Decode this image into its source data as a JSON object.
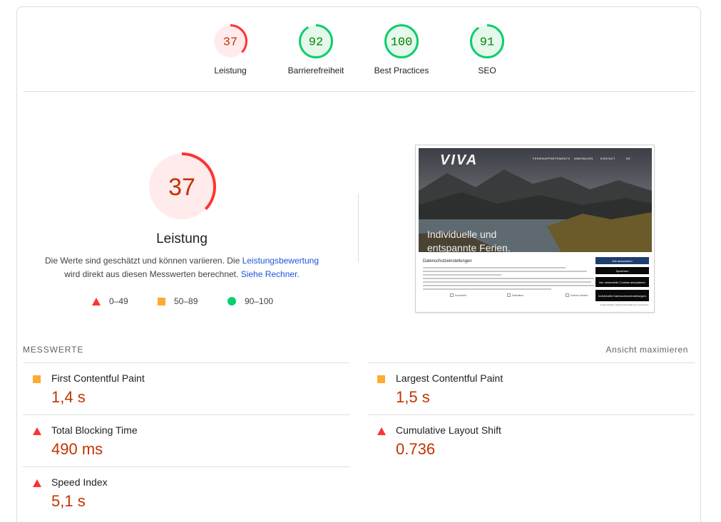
{
  "categories": [
    {
      "name": "Leistung",
      "score": "37",
      "value": 0.37,
      "rating": "fail"
    },
    {
      "name": "Barrierefreiheit",
      "score": "92",
      "value": 0.92,
      "rating": "pass"
    },
    {
      "name": "Best Practices",
      "score": "100",
      "value": 1.0,
      "rating": "pass"
    },
    {
      "name": "SEO",
      "score": "91",
      "value": 0.91,
      "rating": "pass"
    }
  ],
  "colors": {
    "fail": "#ff3333",
    "fail_bg": "#ffebeb",
    "fail_text": "#c33300",
    "average": "#ffaa33",
    "pass": "#0cce6b",
    "pass_bg": "#e6f7ec",
    "pass_text": "#008800"
  },
  "performance": {
    "score": "37",
    "value": 0.37,
    "title": "Leistung",
    "desc_1": "Die Werte sind geschätzt und können variieren. Die ",
    "desc_link_1": "Leistungsbewertung",
    "desc_2": "wird direkt aus diesen Messwerten berechnet. ",
    "desc_link_2": "Siehe Rechner",
    "desc_3": "."
  },
  "legend": [
    {
      "shape": "triangle-icon",
      "range": "0–49"
    },
    {
      "shape": "square-icon",
      "range": "50–89"
    },
    {
      "shape": "circle-icon",
      "range": "90–100"
    }
  ],
  "screenshot": {
    "logo": "VIVA",
    "nav": [
      "FERIENAPPARTEMENTS",
      "IMMOBILIEN",
      "KONTAKT",
      "DE"
    ],
    "hero_line_1": "Individuelle und",
    "hero_line_2": "entspannte Ferien.",
    "banner_title": "Datenschutzeinstellungen",
    "checks": [
      "Essenziell",
      "Statistiken",
      "Externe Medien"
    ],
    "buttons": [
      "Alle akzeptieren",
      "Speichern",
      "Nur essenzielle Cookies akzeptieren",
      "Individuelle Datenschutzeinstellungen"
    ],
    "footer": "Cookie-Details | Datenschutzerklärung | Impressum"
  },
  "metrics": {
    "header": "MESSWERTE",
    "expand": "Ansicht maximieren",
    "items": [
      {
        "name": "First Contentful Paint",
        "value": "1,4 s",
        "rating": "average"
      },
      {
        "name": "Largest Contentful Paint",
        "value": "1,5 s",
        "rating": "average"
      },
      {
        "name": "Total Blocking Time",
        "value": "490 ms",
        "rating": "fail"
      },
      {
        "name": "Cumulative Layout Shift",
        "value": "0.736",
        "rating": "fail"
      },
      {
        "name": "Speed Index",
        "value": "5,1 s",
        "rating": "fail"
      }
    ]
  }
}
